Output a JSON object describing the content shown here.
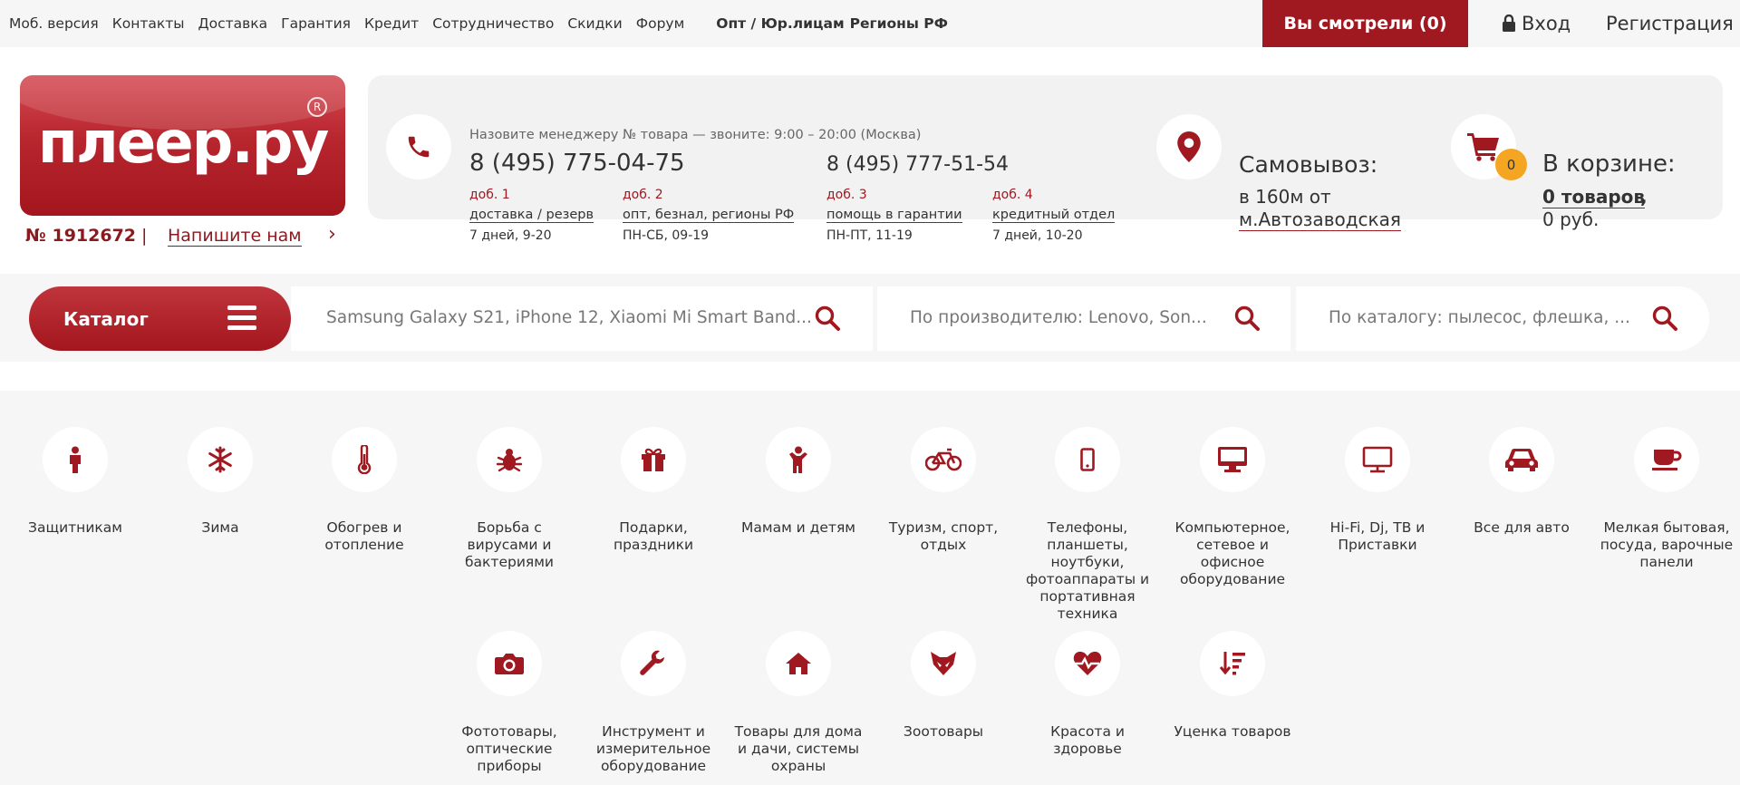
{
  "topnav": {
    "links": [
      "Моб. версия",
      "Контакты",
      "Доставка",
      "Гарантия",
      "Кредит",
      "Сотрудничество",
      "Скидки",
      "Форум"
    ],
    "bold_links": [
      "Опт / Юр.лицам",
      "Регионы РФ"
    ],
    "seen_button": "Вы смотрели (0)",
    "login": "Вход",
    "register": "Регистрация"
  },
  "header": {
    "logo_text": "плеер.ру",
    "logo_reg": "R",
    "order_number": "№ 1912672",
    "separator": "|",
    "write_us": "Напишите нам",
    "hint": "Назовите менеджеру № товара — звоните: 9:00 – 20:00 (Москва)",
    "phone_main": "8 (495) 775-04-75",
    "phone_second": "8 (495) 777-51-54",
    "extensions": [
      {
        "ext": "доб. 1",
        "label": "доставка / резерв",
        "time": "7 дней, 9-20"
      },
      {
        "ext": "доб. 2",
        "label": "опт, безнал, регионы РФ",
        "time": "ПН-СБ, 09-19"
      },
      {
        "ext": "доб. 3",
        "label": "помощь в гарантии",
        "time": "ПН-ПТ, 11-19"
      },
      {
        "ext": "доб. 4",
        "label": "кредитный отдел",
        "time": "7 дней, 10-20"
      }
    ],
    "pickup_title": "Самовывоз:",
    "pickup_text": "в 160м от",
    "pickup_link": "м.Автозаводская",
    "cart_count": "0",
    "cart_title": "В корзине:",
    "cart_items": "0 товаров",
    "cart_comma": ",",
    "cart_sum": "0 руб."
  },
  "search": {
    "catalog_label": "Каталог",
    "field1_placeholder": "Samsung Galaxy S21, iPhone 12, Xiaomi Mi Smart Band...",
    "field2_placeholder": "По производителю: Lenovo, Son...",
    "field3_placeholder": "По каталогу: пылесос, флешка, ..."
  },
  "categories": [
    {
      "icon": "soldier-icon",
      "label": "Защитникам"
    },
    {
      "icon": "snowflake-icon",
      "label": "Зима"
    },
    {
      "icon": "thermometer-icon",
      "label": "Обогрев и отопление"
    },
    {
      "icon": "bug-icon",
      "label": "Борьба с вирусами и бактериями"
    },
    {
      "icon": "gift-icon",
      "label": "Подарки, праздники"
    },
    {
      "icon": "child-icon",
      "label": "Мамам и детям"
    },
    {
      "icon": "bicycle-icon",
      "label": "Туризм, спорт, отдых"
    },
    {
      "icon": "mobile-phone-icon",
      "label": "Телефоны, планшеты, ноутбуки, фотоаппараты и портативная техника"
    },
    {
      "icon": "desktop-icon",
      "label": "Компьютерное, сетевое и офисное оборудование"
    },
    {
      "icon": "tv-icon",
      "label": "Hi-Fi, Dj, ТВ и Приставки"
    },
    {
      "icon": "car-icon",
      "label": "Все для авто"
    },
    {
      "icon": "cup-icon",
      "label": "Мелкая бытовая, посуда, варочные панели"
    },
    {
      "icon": "camera-icon",
      "label": "Фототовары, оптические приборы"
    },
    {
      "icon": "wrench-icon",
      "label": "Инструмент и измерительное оборудование"
    },
    {
      "icon": "home-icon",
      "label": "Товары для дома и дачи, системы охраны"
    },
    {
      "icon": "fox-icon",
      "label": "Зоотовары"
    },
    {
      "icon": "heartbeat-icon",
      "label": "Красота и здоровье"
    },
    {
      "icon": "sort-amount-icon",
      "label": "Уценка товаров"
    }
  ],
  "colors": {
    "brand": "#a01820",
    "badge": "#f4a623",
    "background": "#f6f6f6"
  }
}
